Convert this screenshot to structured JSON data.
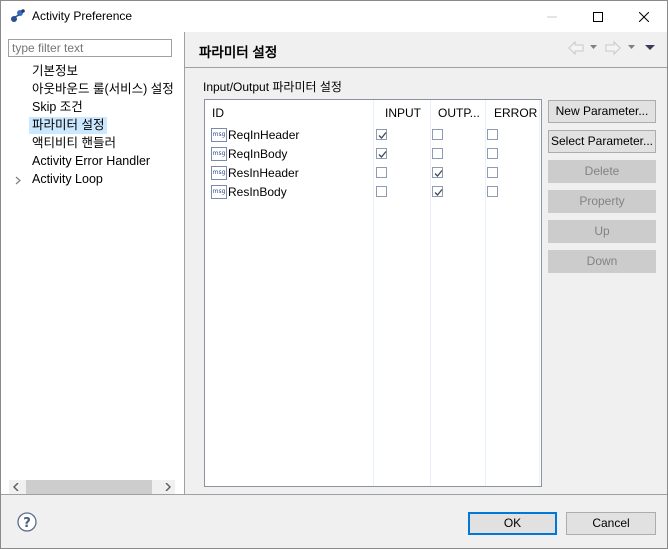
{
  "window": {
    "title": "Activity Preference",
    "icon": "app-icon",
    "controls": [
      "minimize",
      "maximize",
      "close"
    ]
  },
  "sidebar": {
    "filter_placeholder": "type filter text",
    "items": [
      {
        "label": "기본정보",
        "selected": false,
        "expandable": false
      },
      {
        "label": "아웃바운드 룰(서비스) 설정",
        "selected": false,
        "expandable": false
      },
      {
        "label": "Skip 조건",
        "selected": false,
        "expandable": false
      },
      {
        "label": "파라미터 설정",
        "selected": true,
        "expandable": false
      },
      {
        "label": "액티비티 핸들러",
        "selected": false,
        "expandable": false
      },
      {
        "label": "Activity Error Handler",
        "selected": false,
        "expandable": false
      },
      {
        "label": "Activity Loop",
        "selected": false,
        "expandable": true
      }
    ]
  },
  "page": {
    "title": "파라미터 설정",
    "nav_icons": [
      "back-arrow-icon",
      "back-dropdown-icon",
      "forward-arrow-icon",
      "forward-dropdown-icon",
      "view-menu-icon"
    ],
    "group_label": "Input/Output 파라미터 설정",
    "table": {
      "columns": [
        "ID",
        "INPUT",
        "OUTP...",
        "ERROR"
      ],
      "rows": [
        {
          "icon": "msg",
          "id": "ReqInHeader",
          "input": true,
          "output": false,
          "error": false
        },
        {
          "icon": "msg",
          "id": "ReqInBody",
          "input": true,
          "output": false,
          "error": false
        },
        {
          "icon": "msg",
          "id": "ResInHeader",
          "input": false,
          "output": true,
          "error": false
        },
        {
          "icon": "msg",
          "id": "ResInBody",
          "input": false,
          "output": true,
          "error": false
        }
      ]
    },
    "buttons": [
      {
        "label": "New Parameter...",
        "enabled": true
      },
      {
        "label": "Select Parameter...",
        "enabled": true
      },
      {
        "label": "Delete",
        "enabled": false
      },
      {
        "label": "Property",
        "enabled": false
      },
      {
        "label": "Up",
        "enabled": false
      },
      {
        "label": "Down",
        "enabled": false
      }
    ]
  },
  "footer": {
    "ok_label": "OK",
    "cancel_label": "Cancel"
  },
  "colors": {
    "selection": "#cce8ff",
    "default_button_border": "#0078d7"
  }
}
